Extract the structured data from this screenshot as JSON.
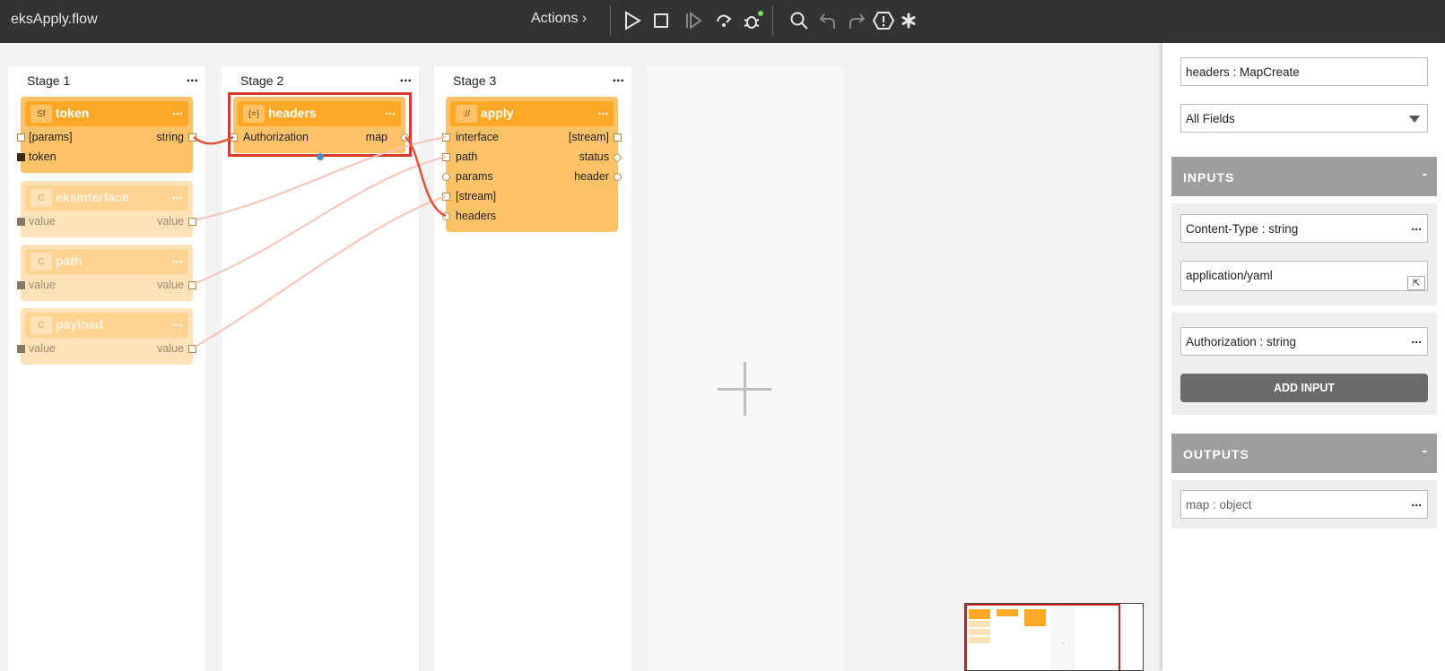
{
  "app": {
    "title": "eksApply.flow",
    "actions_label": "Actions ›"
  },
  "toolbar": {
    "icons": [
      "play-icon",
      "stop-icon",
      "step-icon",
      "step-over-icon",
      "debug-icon",
      "search-icon",
      "undo-icon",
      "redo-icon",
      "warning-icon",
      "asterisk-icon"
    ],
    "accent": "#333333"
  },
  "stages": [
    {
      "title": "Stage 1",
      "menu": "..."
    },
    {
      "title": "Stage 2",
      "menu": "..."
    },
    {
      "title": "Stage 3",
      "menu": "..."
    }
  ],
  "nodes": {
    "token": {
      "icon": "Sf",
      "name": "token",
      "menu": "...",
      "in1": "[params]",
      "out1": "string",
      "in2": "token"
    },
    "eksInterface": {
      "icon": "C",
      "name": "eksInterface",
      "menu": "...",
      "in1": "value",
      "out1": "value"
    },
    "path": {
      "icon": "C",
      "name": "path",
      "menu": "...",
      "in1": "value",
      "out1": "value"
    },
    "payload": {
      "icon": "C",
      "name": "payload",
      "menu": "...",
      "in1": "value",
      "out1": "value"
    },
    "headers": {
      "icon": "{=}",
      "name": "headers",
      "menu": "...",
      "in1": "Authorization",
      "out1": "map"
    },
    "apply": {
      "icon": "://",
      "name": "apply",
      "menu": "...",
      "in1": "interface",
      "in2": "path",
      "in3": "params",
      "in4": "[stream]",
      "in5": "headers",
      "out1": "[stream]",
      "out2": "status",
      "out3": "header"
    }
  },
  "panel": {
    "node_title": "headers : MapCreate",
    "filter": "All Fields",
    "inputs_label": "INPUTS",
    "inputs_toggle": "-",
    "input1_name": "Content-Type : string",
    "input1_value": "application/yaml",
    "input2_name": "Authorization : string",
    "add_input_label": "ADD INPUT",
    "outputs_label": "OUTPUTS",
    "outputs_toggle": "-",
    "output1_name": "map : object",
    "menu": "..."
  },
  "colors": {
    "node": "#ffa726",
    "selection": "#d93a2b",
    "link": "#e0543a"
  }
}
